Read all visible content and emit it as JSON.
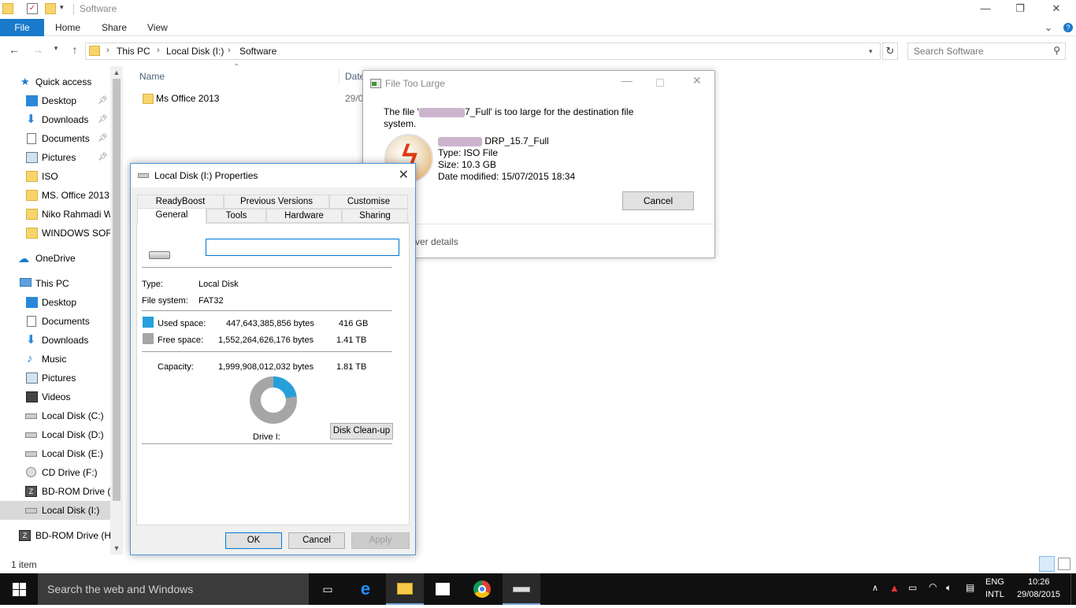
{
  "window": {
    "title": "Software",
    "minimize": "—",
    "maximize": "❐",
    "close": "✕",
    "help": "?"
  },
  "ribbon": {
    "file": "File",
    "tabs": [
      "Home",
      "Share",
      "View"
    ],
    "collapse": "⌄"
  },
  "address": {
    "segments": [
      "This PC",
      "Local Disk (I:)",
      "Software"
    ],
    "search_placeholder": "Search Software"
  },
  "nav": {
    "quick_access": "Quick access",
    "quick_items": [
      "Desktop",
      "Downloads",
      "Documents",
      "Pictures",
      "ISO",
      "MS. Office 2013",
      "Niko Rahmadi W",
      "WINDOWS SOFT"
    ],
    "onedrive": "OneDrive",
    "this_pc": "This PC",
    "pc_items": [
      "Desktop",
      "Documents",
      "Downloads",
      "Music",
      "Pictures",
      "Videos",
      "Local Disk (C:)",
      "Local Disk (D:)",
      "Local Disk (E:)",
      "CD Drive (F:)",
      "BD-ROM Drive (I",
      "Local Disk (I:)"
    ],
    "bd_rom_h": "BD-ROM Drive (H"
  },
  "content": {
    "col_name": "Name",
    "col_date": "Date",
    "files": [
      {
        "name": "Ms Office 2013",
        "date": "29/0"
      }
    ],
    "status": "1 item"
  },
  "properties": {
    "title": "Local Disk (I:) Properties",
    "tabs_top": [
      "ReadyBoost",
      "Previous Versions",
      "Customise"
    ],
    "tabs_bottom": [
      "General",
      "Tools",
      "Hardware",
      "Sharing"
    ],
    "type_label": "Type:",
    "type_value": "Local Disk",
    "fs_label": "File system:",
    "fs_value": "FAT32",
    "used_label": "Used space:",
    "used_bytes": "447,643,385,856 bytes",
    "used_human": "416 GB",
    "free_label": "Free space:",
    "free_bytes": "1,552,264,626,176 bytes",
    "free_human": "1.41 TB",
    "cap_label": "Capacity:",
    "cap_bytes": "1,999,908,012,032 bytes",
    "cap_human": "1.81 TB",
    "drive_label": "Drive I:",
    "cleanup": "Disk Clean-up",
    "ok": "OK",
    "cancel": "Cancel",
    "apply": "Apply",
    "used_fraction": 0.224,
    "colors": {
      "used": "#26a0da",
      "free": "#a6a6a6"
    }
  },
  "file_too_large": {
    "title": "File Too Large",
    "msg_prefix": "The file '",
    "msg_suffix": "7_Full' is too large for the destination file",
    "msg_line2": "system.",
    "file_name": "DRP_15.7_Full",
    "type": "Type: ISO File",
    "size": "Size: 10.3 GB",
    "modified": "Date modified: 15/07/2015 18:34",
    "cancel": "Cancel",
    "details": "ver details"
  },
  "taskbar": {
    "search": "Search the web and Windows",
    "lang1": "ENG",
    "lang2": "INTL",
    "time": "10:26",
    "date": "29/08/2015"
  }
}
